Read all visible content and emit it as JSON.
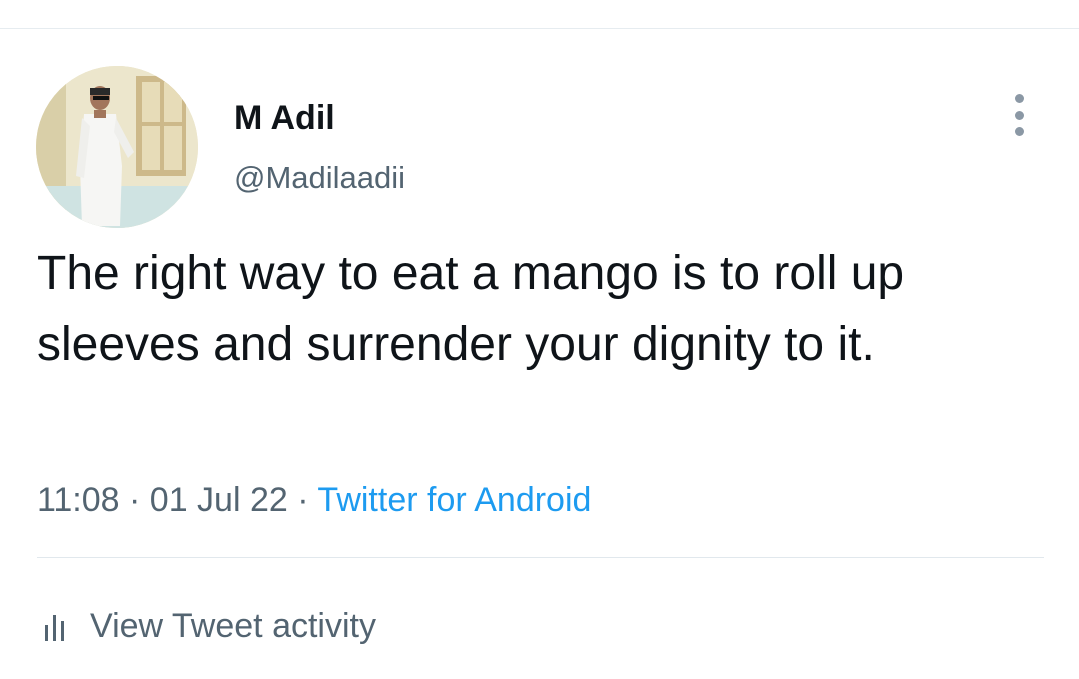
{
  "tweet": {
    "author": {
      "display_name": "M Adil",
      "handle": "@Madilaadii"
    },
    "text": "The right way to eat a mango is to roll up sleeves and surrender your dignity to it.",
    "time": "11:08",
    "date": "01 Jul 22",
    "separator": "·",
    "source": "Twitter for Android",
    "activity_label": "View Tweet activity"
  },
  "icons": {
    "more": "more-vertical-icon",
    "activity": "bar-chart-icon"
  },
  "colors": {
    "primary_text": "#0f1419",
    "secondary_text": "#536471",
    "link": "#1d9bf0"
  }
}
